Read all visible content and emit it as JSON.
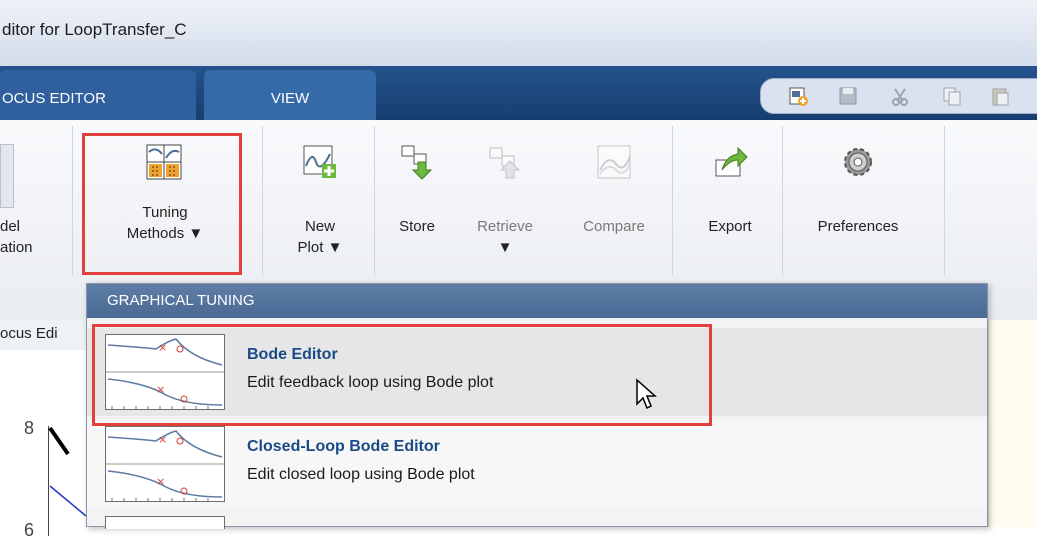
{
  "window": {
    "title": "ditor for LoopTransfer_C"
  },
  "tabs": [
    {
      "label": "OCUS EDITOR"
    },
    {
      "label": "VIEW"
    }
  ],
  "quick_access_icons": [
    "new-session-icon",
    "save-icon",
    "cut-icon",
    "copy-icon",
    "paste-icon"
  ],
  "toolstrip": {
    "model_label_line1": "del",
    "model_label_line2": "ation",
    "tuning_methods_line1": "Tuning",
    "tuning_methods_line2": "Methods",
    "new_plot_line1": "New",
    "new_plot_line2": "Plot",
    "store": "Store",
    "retrieve": "Retrieve",
    "compare": "Compare",
    "export": "Export",
    "preferences": "Preferences"
  },
  "editor_tab_label": "ocus Edi",
  "plot_axis": {
    "tick_top": "8",
    "tick_bottom": "6"
  },
  "dropdown": {
    "header": "GRAPHICAL TUNING",
    "items": [
      {
        "title": "Bode Editor",
        "description": "Edit feedback loop using Bode plot"
      },
      {
        "title": "Closed-Loop Bode Editor",
        "description": "Edit closed loop using Bode plot"
      }
    ]
  },
  "colors": {
    "highlight": "#e2403d",
    "ribbon_blue": "#24538d",
    "dropdown_header": "#5e7ea7",
    "link_blue": "#1a4a88"
  }
}
